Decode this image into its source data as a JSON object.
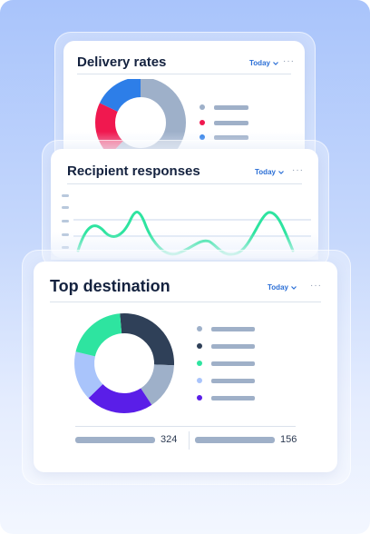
{
  "cards": {
    "delivery": {
      "title": "Delivery rates",
      "period": "Today",
      "donut_colors": [
        "#9eb0c9",
        "#f0184f",
        "#2d7ee8"
      ],
      "legend_colors": [
        "#9eb0c9",
        "#f0184f",
        "#2d7ee8"
      ]
    },
    "responses": {
      "title": "Recipient responses",
      "period": "Today",
      "line_color": "#2ee4a0"
    },
    "destination": {
      "title": "Top destination",
      "period": "Today",
      "donut_colors": [
        "#2f4058",
        "#9eb0c9",
        "#5a1ee8",
        "#a9c4fb",
        "#2ee4a0"
      ],
      "legend_colors": [
        "#9eb0c9",
        "#2f4058",
        "#2ee4a0",
        "#a9c4fb",
        "#5a1ee8"
      ],
      "stats": [
        {
          "value": "324"
        },
        {
          "value": "156"
        }
      ]
    }
  }
}
